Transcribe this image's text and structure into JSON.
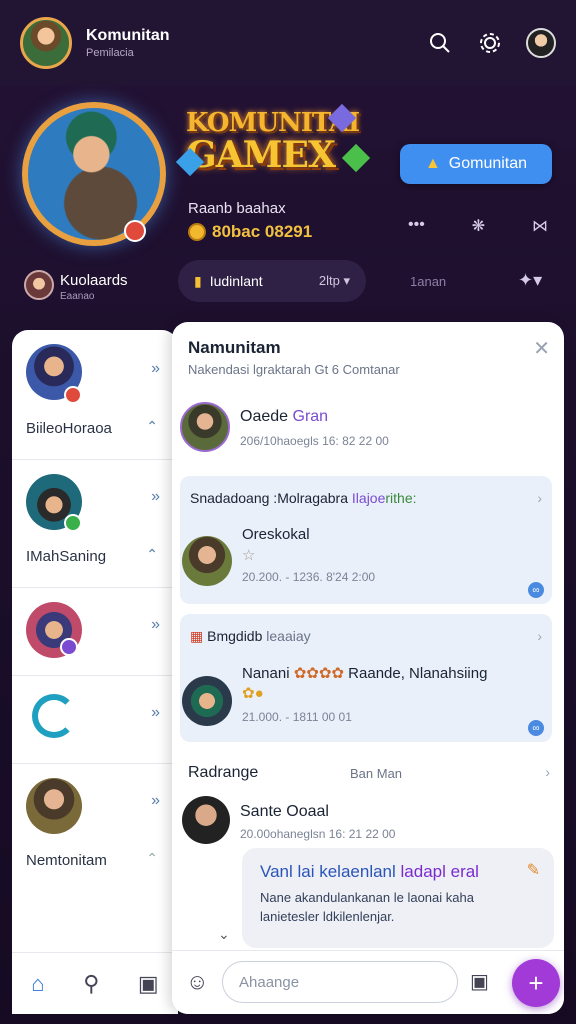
{
  "header": {
    "title": "Komunitan",
    "subtitle": "Pemilacia",
    "icons": [
      "search-icon",
      "settings-icon",
      "profile-avatar"
    ]
  },
  "hero": {
    "logo_line1": "KOMUNITAI",
    "logo_line2": "GAMEX",
    "button_label": "Gomunitan",
    "meta_line1": "Raanb baahax",
    "meta_line2": "80bac 08291",
    "colors": {
      "accent": "#3f8ff0",
      "gold": "#f2c040",
      "bg": "#1b0f2b"
    }
  },
  "subbar": {
    "user_name": "Kuolaards",
    "user_sub": "Eaanao",
    "pill_label": "Iudinlant",
    "pill_right": "2ltp",
    "mid_label": "1anan"
  },
  "sidebar": {
    "items": [
      {
        "label": "BiileoHoraoa"
      },
      {
        "label": "IMahSaning"
      },
      {
        "label": ""
      },
      {
        "label": ""
      },
      {
        "label": "Nemtonitam"
      }
    ]
  },
  "main": {
    "title": "Namunitam",
    "subtitle": "Nakendasi lgraktarah Gt 6 Comtanar",
    "post1": {
      "name": "Oaede",
      "name_accent": "Gran",
      "meta": "206/10haoegls 16: 82 22 00"
    },
    "card1": {
      "head_a": "Snadadoang :Molragabra",
      "head_b": "Ilajoe",
      "head_c": "rithe:",
      "name": "Oreskokal",
      "meta": "20.200. - 1236. 8'24 2:00"
    },
    "card2": {
      "head_a": "Bmgdidb",
      "head_b": "leaaiay",
      "name": "Nanani",
      "name_rest": "Raande, Nlanahsiing",
      "meta": "21.000. - 1811 00 01"
    },
    "section2": {
      "title": "Radrange",
      "right_label": "Ban Man",
      "name": "Sante Ooaal",
      "meta": "20.00ohaneglsn 16: 21 22 00",
      "bubble_title_a": "Vanl lai kelaenlanl",
      "bubble_title_b": "ladapl eral",
      "bubble_body": "Nane akandulankanan le laonai kaha lanietesler ldkilenlenjar."
    },
    "input": {
      "placeholder": "Ahaange"
    }
  }
}
